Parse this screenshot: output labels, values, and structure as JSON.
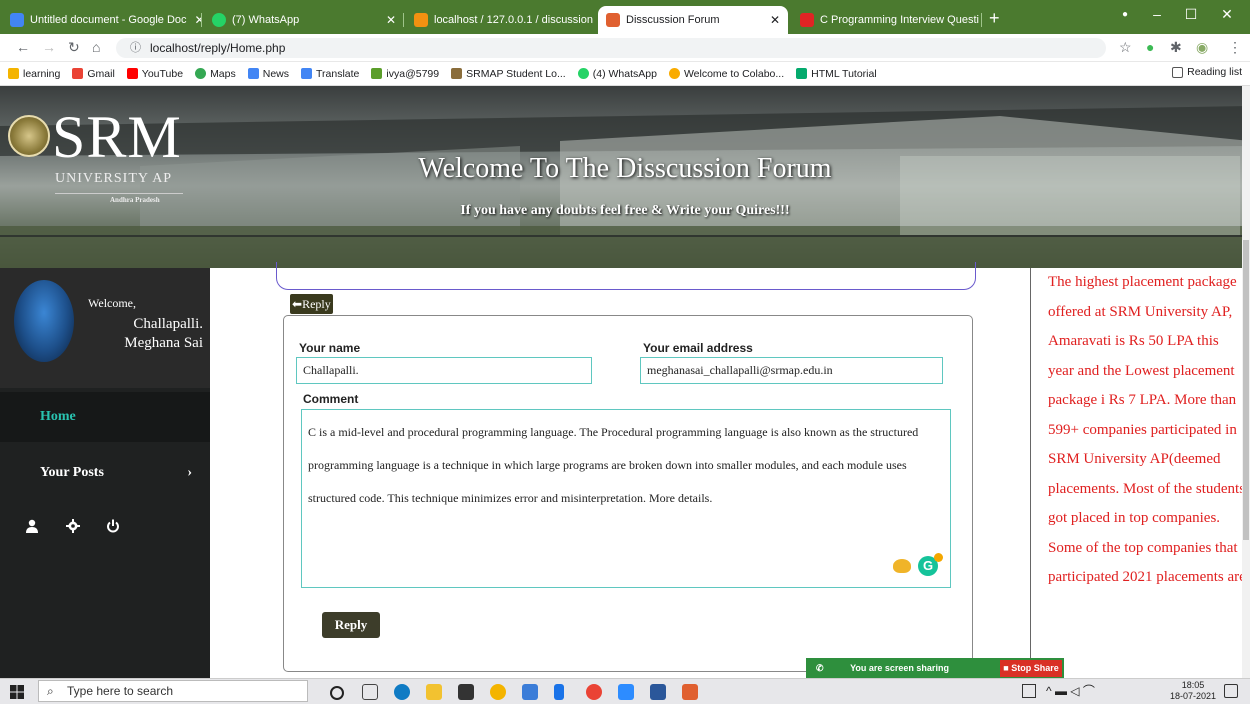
{
  "browser": {
    "tabs": [
      {
        "title": "Untitled document - Google Doc",
        "color": "#4285f4"
      },
      {
        "title": "(7) WhatsApp",
        "color": "#25d366"
      },
      {
        "title": "localhost / 127.0.0.1 / discussion",
        "color": "#f29111"
      },
      {
        "title": "Disscussion Forum",
        "color": "#e06030",
        "active": true
      },
      {
        "title": "C Programming Interview Questi",
        "color": "#e02424"
      }
    ],
    "url": "localhost/reply/Home.php",
    "bookmarks": [
      {
        "label": "learning",
        "color": "#f4b400"
      },
      {
        "label": "Gmail",
        "color": "#ea4335"
      },
      {
        "label": "YouTube",
        "color": "#ff0000"
      },
      {
        "label": "Maps",
        "color": "#34a853"
      },
      {
        "label": "News",
        "color": "#4285f4"
      },
      {
        "label": "Translate",
        "color": "#4285f4"
      },
      {
        "label": "ivya@5799",
        "color": "#5b9e2a"
      },
      {
        "label": "SRMAP Student Lo...",
        "color": "#8a6d3b"
      },
      {
        "label": "(4) WhatsApp",
        "color": "#25d366"
      },
      {
        "label": "Welcome to Colabo...",
        "color": "#f9ab00"
      },
      {
        "label": "HTML Tutorial",
        "color": "#04aa6d"
      }
    ],
    "reading_list": "Reading list"
  },
  "banner": {
    "logo_srm": "SRM",
    "logo_university": "UNIVERSITY AP",
    "logo_state": "Andhra Pradesh",
    "title": "Welcome To The Disscussion Forum",
    "subtitle": "If you have any doubts feel free & Write your Quires!!!"
  },
  "sidebar": {
    "welcome": "Welcome,",
    "user_name": "Challapalli. Meghana Sai",
    "nav_home": "Home",
    "nav_posts": "Your Posts"
  },
  "form": {
    "back_label": "Reply",
    "name_label": "Your name",
    "name_value": "Challapalli.",
    "email_label": "Your email address",
    "email_value": "meghanasai_challapalli@srmap.edu.in",
    "comment_label": "Comment",
    "comment_value": "C is a mid-level and procedural programming language. The Procedural programming language is also known as the structured programming language is a technique in which large programs are broken down into smaller modules, and each module uses structured code. This technique minimizes error and misinterpretation. More details.",
    "submit_label": "Reply"
  },
  "right_panel": {
    "text": "The highest placement package offered at SRM University AP, Amaravati is Rs 50 LPA this year and the Lowest placement package i Rs 7 LPA. More than 599+ companies participated in SRM University AP(deemed placements. Most of the students got placed in top companies. Some of the top companies that participated 2021 placements are"
  },
  "screen_share": {
    "message": "You are screen sharing",
    "stop": "Stop Share"
  },
  "taskbar": {
    "search_placeholder": "Type here to search",
    "time": "18:05",
    "date": "18-07-2021"
  }
}
